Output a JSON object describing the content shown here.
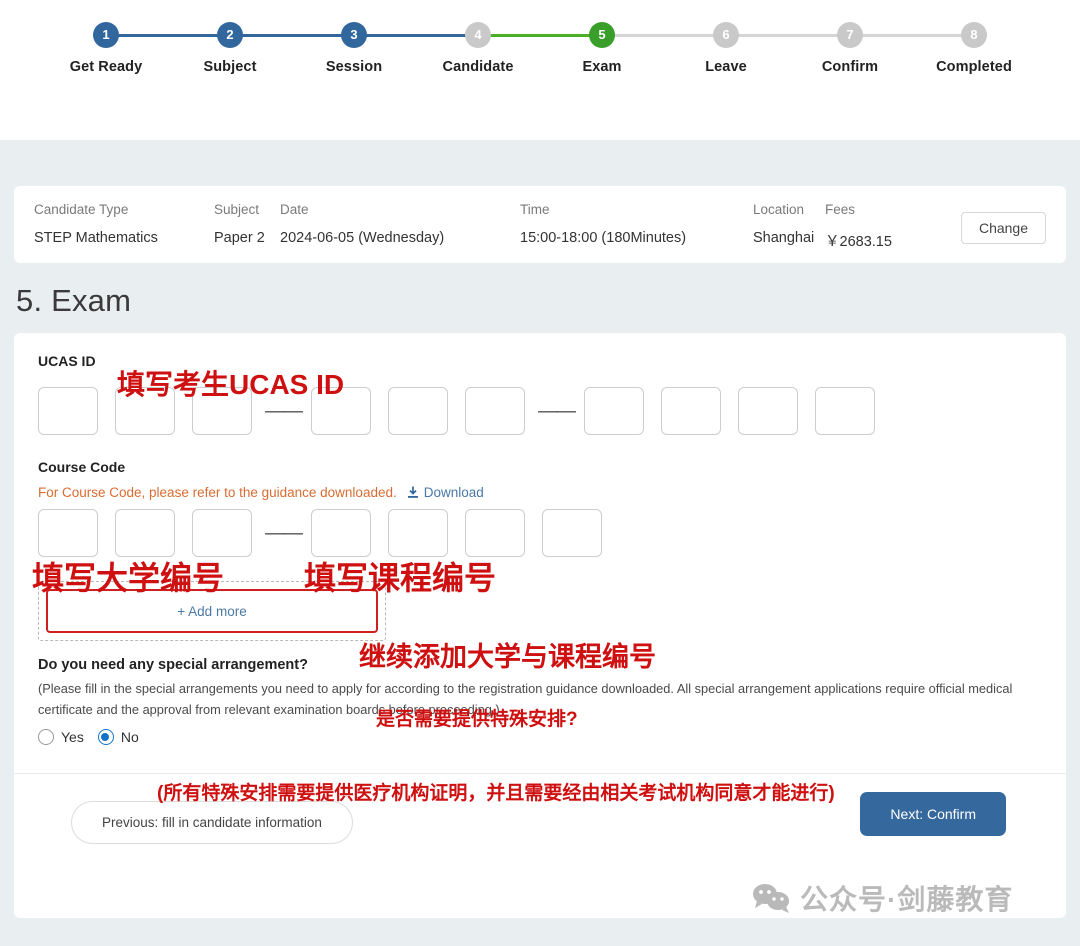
{
  "stepper": {
    "steps": [
      {
        "num": "1",
        "label": "Get Ready",
        "state": "done"
      },
      {
        "num": "2",
        "label": "Subject",
        "state": "done"
      },
      {
        "num": "3",
        "label": "Session",
        "state": "done"
      },
      {
        "num": "4",
        "label": "Candidate",
        "state": "predone"
      },
      {
        "num": "5",
        "label": "Exam",
        "state": "current"
      },
      {
        "num": "6",
        "label": "Leave",
        "state": "todo"
      },
      {
        "num": "7",
        "label": "Confirm",
        "state": "todo"
      },
      {
        "num": "8",
        "label": "Completed",
        "state": "todo"
      }
    ],
    "colors": {
      "done": "#31679c",
      "current": "#3a9e2a",
      "todo": "#c9c9c9"
    }
  },
  "info": {
    "headers": {
      "candidate_type": "Candidate Type",
      "subject": "Subject",
      "date": "Date",
      "time": "Time",
      "location": "Location",
      "fees": "Fees"
    },
    "values": {
      "candidate_type": "STEP Mathematics",
      "subject": "Paper 2",
      "date": "2024-06-05 (Wednesday)",
      "time": "15:00-18:00 (180Minutes)",
      "location": "Shanghai",
      "fees": "￥2683.15"
    },
    "change_label": "Change"
  },
  "page_title": "5. Exam",
  "form": {
    "ucas_label": "UCAS ID",
    "ucas_boxes": [
      "",
      "",
      "",
      "",
      "",
      "",
      "",
      "",
      "",
      ""
    ],
    "dash": "——",
    "course_code_label": "Course Code",
    "course_hint": "For Course Code, please refer to the guidance downloaded.",
    "download_label": "Download",
    "course_boxes": [
      "",
      "",
      "",
      "",
      "",
      "",
      ""
    ],
    "add_more_label": "+ Add more",
    "question": "Do you need any special arrangement?",
    "question_note": "(Please fill in the special arrangements you need to apply for according to the registration guidance downloaded. All special arrangement applications require official medical certificate and the approval from relevant examination boards before proceeding.)",
    "radio_yes": "Yes",
    "radio_no": "No",
    "radio_selected": "No",
    "prev_label": "Previous: fill in candidate information",
    "next_label": "Next: Confirm"
  },
  "annotations": {
    "ucas": "填写考生UCAS ID",
    "university": "填写大学编号",
    "course": "填写课程编号",
    "add_more": "继续添加大学与课程编号",
    "special": "是否需要提供特殊安排?",
    "medical": "(所有特殊安排需要提供医疗机构证明，并且需要经由相关考试机构同意才能进行)",
    "color": "#cf1010"
  },
  "watermark": {
    "text": "公众号·剑藤教育",
    "icon": "wechat-icon"
  }
}
